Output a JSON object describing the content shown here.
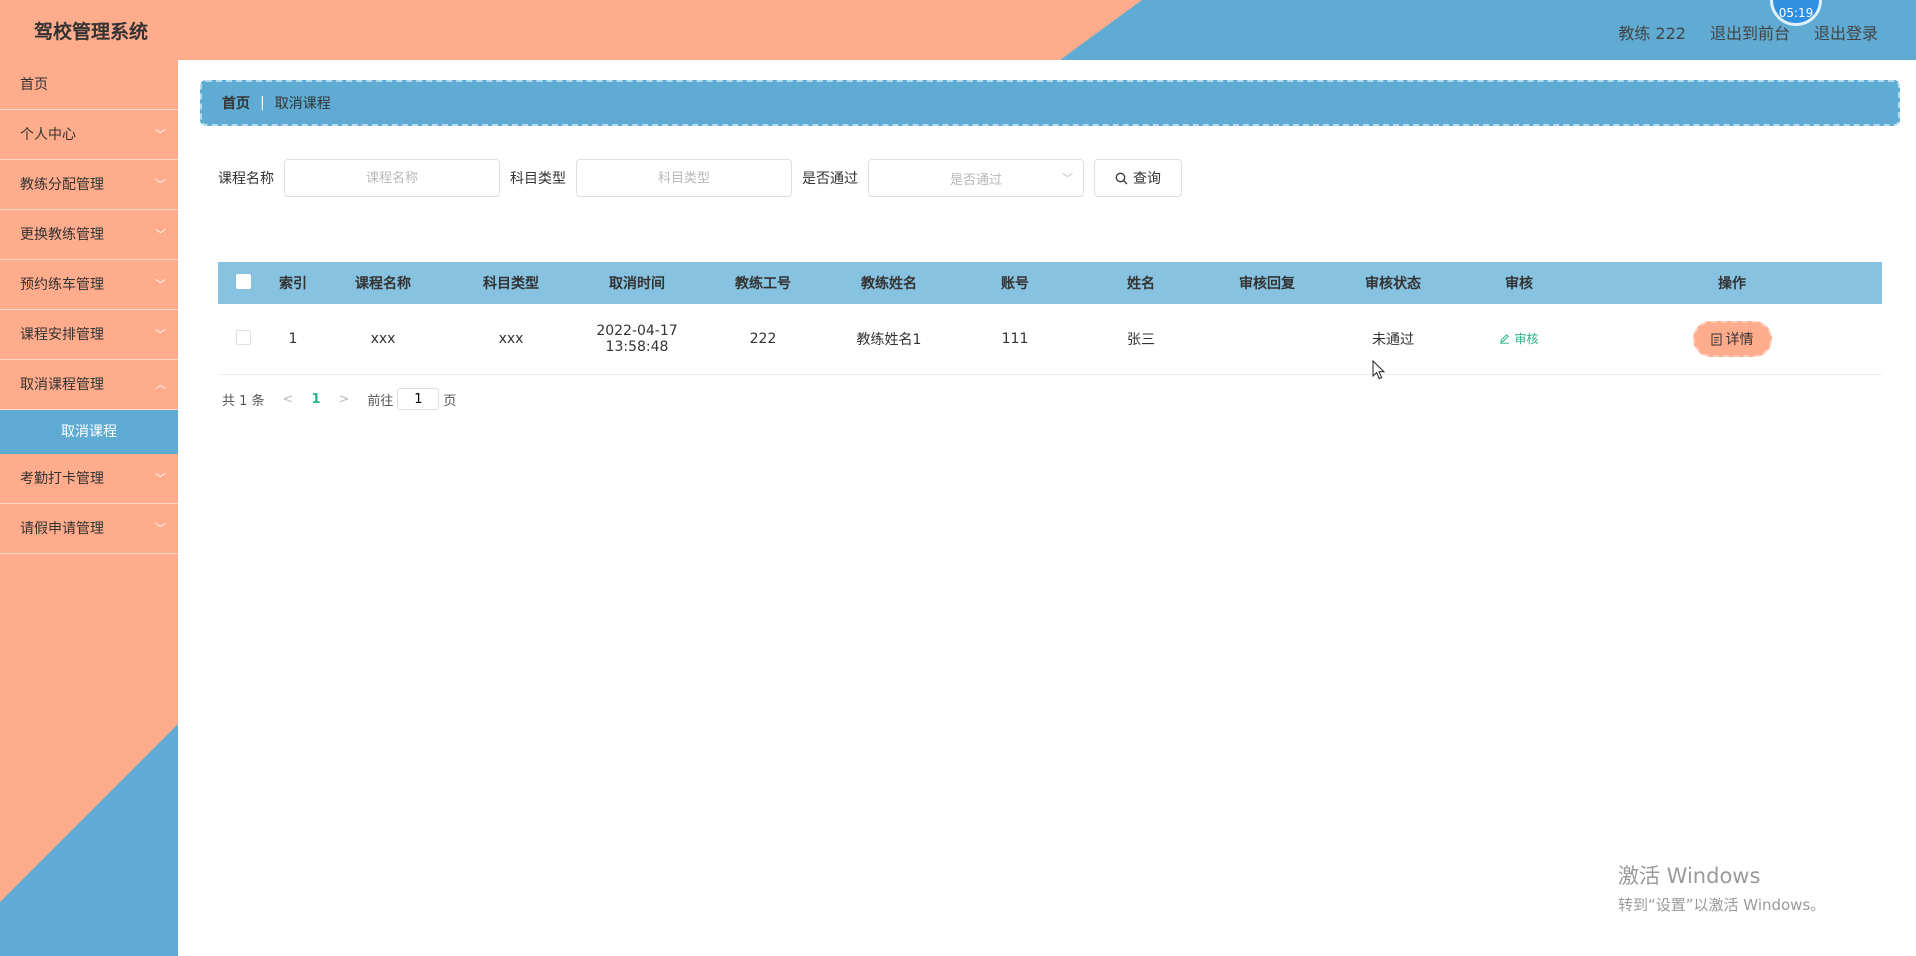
{
  "app": {
    "title": "驾校管理系统"
  },
  "header": {
    "user_label": "教练 222",
    "front_label": "退出到前台",
    "logout_label": "退出登录",
    "clock": "05:19"
  },
  "sidebar": {
    "items": [
      {
        "label": "首页"
      },
      {
        "label": "个人中心"
      },
      {
        "label": "教练分配管理"
      },
      {
        "label": "更换教练管理"
      },
      {
        "label": "预约练车管理"
      },
      {
        "label": "课程安排管理"
      },
      {
        "label": "取消课程管理"
      },
      {
        "label": "考勤打卡管理"
      },
      {
        "label": "请假申请管理"
      }
    ],
    "submenu_active": "取消课程"
  },
  "breadcrumb": {
    "home": "首页",
    "sep": "|",
    "current": "取消课程"
  },
  "search": {
    "course_label": "课程名称",
    "course_placeholder": "课程名称",
    "subject_label": "科目类型",
    "subject_placeholder": "科目类型",
    "pass_label": "是否通过",
    "pass_placeholder": "是否通过",
    "button_label": "查询"
  },
  "table": {
    "headers": [
      "索引",
      "课程名称",
      "科目类型",
      "取消时间",
      "教练工号",
      "教练姓名",
      "账号",
      "姓名",
      "审核回复",
      "审核状态",
      "审核",
      "操作"
    ],
    "rows": [
      {
        "index": "1",
        "course": "xxx",
        "subject": "xxx",
        "cancel_time": "2022-04-17 13:58:48",
        "coach_id": "222",
        "coach_name": "教练姓名1",
        "account": "111",
        "name": "张三",
        "reply": "",
        "status": "未通过",
        "audit_label": "审核",
        "detail_label": "详情"
      }
    ]
  },
  "pagination": {
    "total": "共 1 条",
    "current": "1",
    "goto_label": "前往",
    "goto_value": "1",
    "page_suffix": "页"
  },
  "watermark": {
    "line1": "激活 Windows",
    "line2": "转到“设置”以激活 Windows。"
  },
  "colors": {
    "salmon": "#ffac8c",
    "blue": "#5fabd3",
    "header_row": "#87c2e0",
    "link_green": "#27b487"
  }
}
